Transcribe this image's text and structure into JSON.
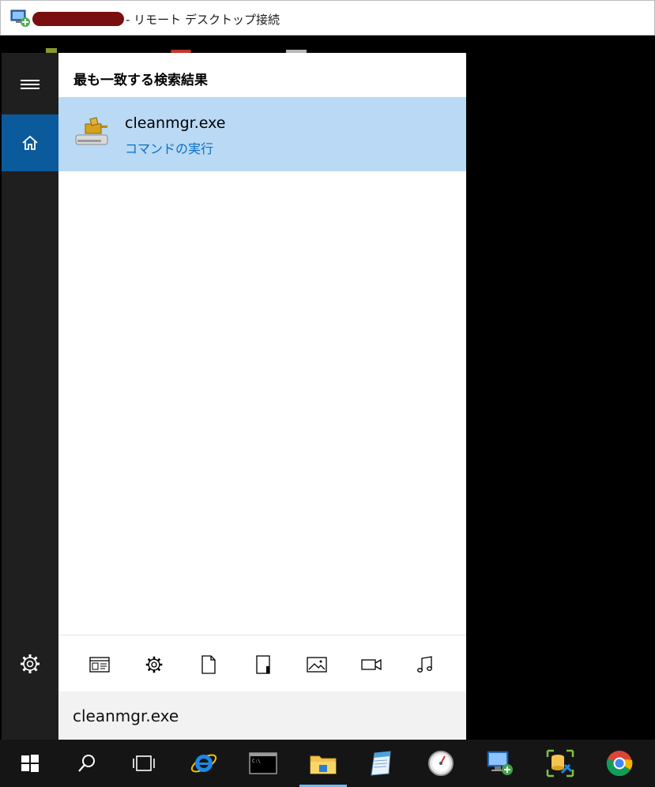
{
  "window": {
    "title": "- リモート デスクトップ接続",
    "icon": "remote-desktop-icon"
  },
  "start_menu": {
    "rail": {
      "menu_icon": "hamburger-icon",
      "home_icon": "home-icon",
      "settings_icon": "gear-icon"
    },
    "results": {
      "header": "最も一致する検索結果",
      "best_match": {
        "name": "cleanmgr.exe",
        "subtitle": "コマンドの実行",
        "icon": "disk-cleanup-icon"
      }
    },
    "filters": [
      {
        "name": "apps-filter-icon"
      },
      {
        "name": "settings-filter-icon"
      },
      {
        "name": "documents-filter-icon"
      },
      {
        "name": "folders-filter-icon"
      },
      {
        "name": "photos-filter-icon"
      },
      {
        "name": "videos-filter-icon"
      },
      {
        "name": "music-filter-icon"
      }
    ],
    "search": {
      "value": "cleanmgr.exe"
    }
  },
  "taskbar": {
    "items": [
      "windows-start-icon",
      "search-icon",
      "task-view-icon",
      "internet-explorer-icon",
      "command-prompt-icon",
      "file-explorer-icon",
      "notepad-icon",
      "performance-monitor-icon",
      "remote-desktop-icon",
      "server-tools-icon",
      "chrome-icon"
    ],
    "accent": "#76b9ed"
  },
  "colors": {
    "home_highlight": "#0b5a9b",
    "result_highlight": "#b9d9f4",
    "subtitle_link": "#0b6fc7"
  }
}
